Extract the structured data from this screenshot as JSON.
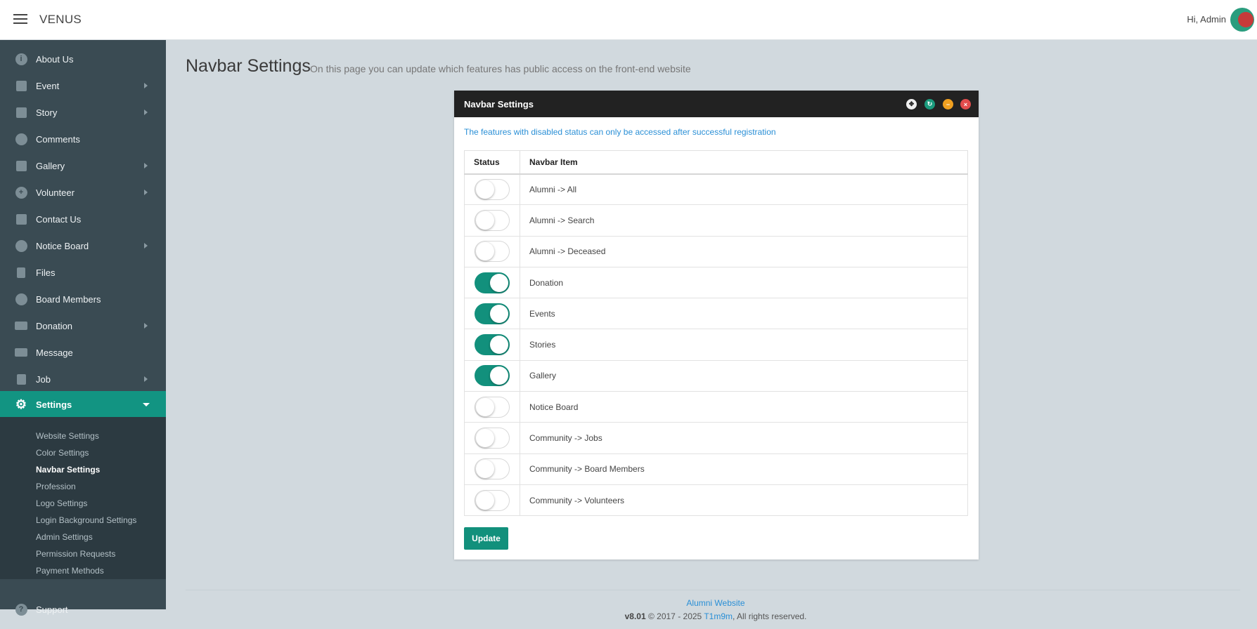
{
  "topbar": {
    "brand": "VENUS",
    "greeting": "Hi, Admin"
  },
  "sidebar": {
    "items": [
      {
        "label": "About Us",
        "icon": "info-icon",
        "has_arrow": false
      },
      {
        "label": "Event",
        "icon": "calendar-icon",
        "has_arrow": true
      },
      {
        "label": "Story",
        "icon": "book-icon",
        "has_arrow": true
      },
      {
        "label": "Comments",
        "icon": "comments-icon",
        "has_arrow": false
      },
      {
        "label": "Gallery",
        "icon": "gallery-icon",
        "has_arrow": true
      },
      {
        "label": "Volunteer",
        "icon": "lifebuoy-icon",
        "has_arrow": true
      },
      {
        "label": "Contact Us",
        "icon": "bank-icon",
        "has_arrow": false
      },
      {
        "label": "Notice Board",
        "icon": "podcast-icon",
        "has_arrow": true
      },
      {
        "label": "Files",
        "icon": "file-icon",
        "has_arrow": false
      },
      {
        "label": "Board Members",
        "icon": "user-circle-icon",
        "has_arrow": false
      },
      {
        "label": "Donation",
        "icon": "credit-card-icon",
        "has_arrow": true
      },
      {
        "label": "Message",
        "icon": "envelope-icon",
        "has_arrow": false
      },
      {
        "label": "Job",
        "icon": "lock-icon",
        "has_arrow": true
      },
      {
        "label": "Settings",
        "icon": "gear-icon",
        "has_arrow": true
      }
    ],
    "settings_submenu": [
      "Website Settings",
      "Color Settings",
      "Navbar Settings",
      "Profession",
      "Logo Settings",
      "Login Background Settings",
      "Admin Settings",
      "Permission Requests",
      "Payment Methods"
    ],
    "support_label": "Support"
  },
  "main": {
    "title": "Navbar Settings",
    "subtitle": "On this page you can update which features has public access on the front-end website"
  },
  "panel": {
    "title": "Navbar Settings",
    "info": "The features with disabled status can only be accessed after successful registration",
    "col_status": "Status",
    "col_item": "Navbar Item",
    "rows": [
      {
        "label": "Alumni -> All",
        "enabled": false
      },
      {
        "label": "Alumni -> Search",
        "enabled": false
      },
      {
        "label": "Alumni -> Deceased",
        "enabled": false
      },
      {
        "label": "Donation",
        "enabled": true
      },
      {
        "label": "Events",
        "enabled": true
      },
      {
        "label": "Stories",
        "enabled": true
      },
      {
        "label": "Gallery",
        "enabled": true
      },
      {
        "label": "Notice Board",
        "enabled": false
      },
      {
        "label": "Community -> Jobs",
        "enabled": false
      },
      {
        "label": "Community -> Board Members",
        "enabled": false
      },
      {
        "label": "Community -> Volunteers",
        "enabled": false
      }
    ],
    "update_label": "Update"
  },
  "footer": {
    "site": "Alumni Website",
    "version": "v8.01",
    "copyright": "© 2017 - 2025",
    "author": "T1m9m",
    "rights": ", All rights reserved."
  },
  "colors": {
    "accent": "#12907c",
    "sidebar": "#3a4b53",
    "link": "#2a8fd6"
  }
}
